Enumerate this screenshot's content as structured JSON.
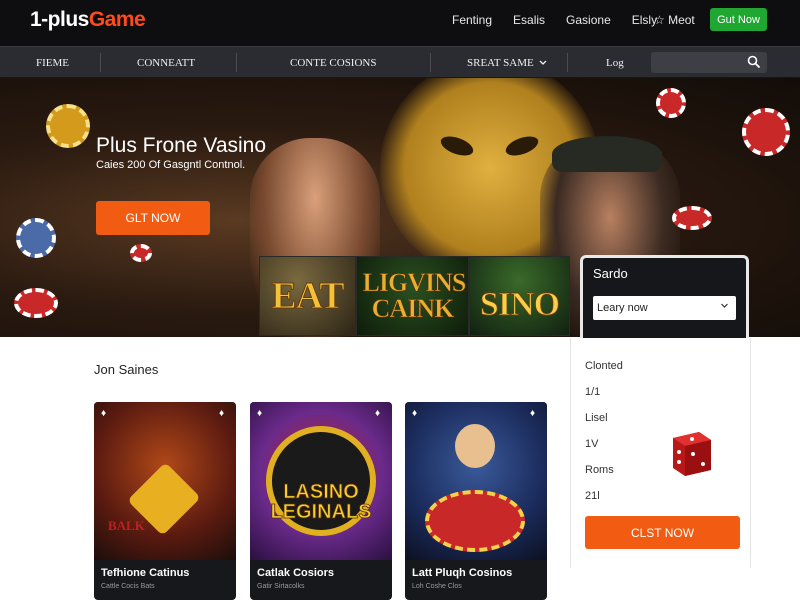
{
  "header": {
    "logo_main": "1-plus",
    "logo_accent": "Game",
    "links": [
      "Fenting",
      "Esalis",
      "Gasione",
      "Elsly"
    ],
    "meet_label": "☆ Meot",
    "getnow_label": "Gut Now",
    "getnow_color": "#1fa732"
  },
  "nav": {
    "items": [
      "FIEME",
      "CONNEATT",
      "CONTE COSIONS",
      "SREAT SAME",
      "Log"
    ],
    "dropdown_icon": "chevron-down-icon",
    "search_icon": "search-icon"
  },
  "hero": {
    "title": "Plus Frone Vasino",
    "subtitle": "Caies 200 Of Gasgntl Contnol.",
    "cta_label": "GLT NOW",
    "accent_color": "#f25c12"
  },
  "tiles": [
    {
      "text": "EAT"
    },
    {
      "text": "LIGVINS CAINK"
    },
    {
      "text": "SINO"
    }
  ],
  "sidebar": {
    "title": "Sardo",
    "select_value": "Leary now",
    "rows": [
      "Clonted",
      "1/1",
      "Lisel",
      "1V",
      "Roms",
      "21l"
    ],
    "dice_icon": "dice-icon",
    "cta_label": "CLST NOW"
  },
  "games": {
    "section_title": "Jon Saines",
    "cards": [
      {
        "name": "Tefhione Catinus",
        "sub": "Cattle Cocis Bats",
        "art_text": "BALK"
      },
      {
        "name": "Catlak Cosiors",
        "sub": "Gatir Sirtacolks",
        "art_text": "LASINO LEGINALS"
      },
      {
        "name": "Latt Pluqh Cosinos",
        "sub": "Loh Coshe Clos",
        "art_text": ""
      }
    ]
  }
}
